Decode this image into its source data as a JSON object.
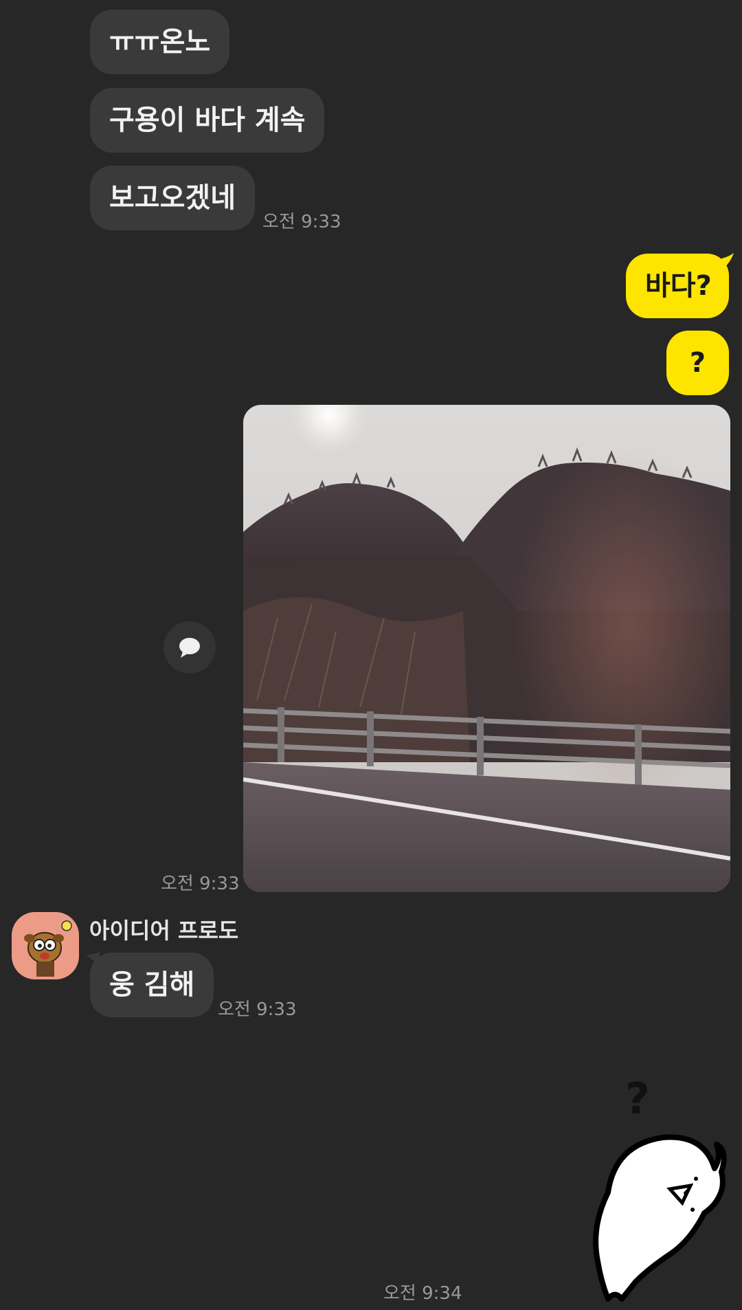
{
  "messages_in_top": [
    {
      "text": "ㅠㅠ온노"
    },
    {
      "text": "구용이 바다 계속"
    },
    {
      "text": "보고오겠네"
    }
  ],
  "time_in_top": "오전 9:33",
  "messages_out": [
    {
      "text": "바다?"
    },
    {
      "text": "?"
    }
  ],
  "photo_message": {
    "time": "오전 9:33",
    "share_icon": "speech-bubble-icon"
  },
  "friend": {
    "name": "아이디어 프로도",
    "avatar_icon": "frodo-avatar-icon",
    "message": "웅 김해",
    "time": "오전 9:33"
  },
  "sticker_message": {
    "sticker_text": "?",
    "time": "오전 9:34"
  },
  "colors": {
    "background": "#272727",
    "incoming_bubble": "#3a3a3a",
    "outgoing_bubble": "#fee500",
    "timestamp": "#9a9a9a"
  }
}
